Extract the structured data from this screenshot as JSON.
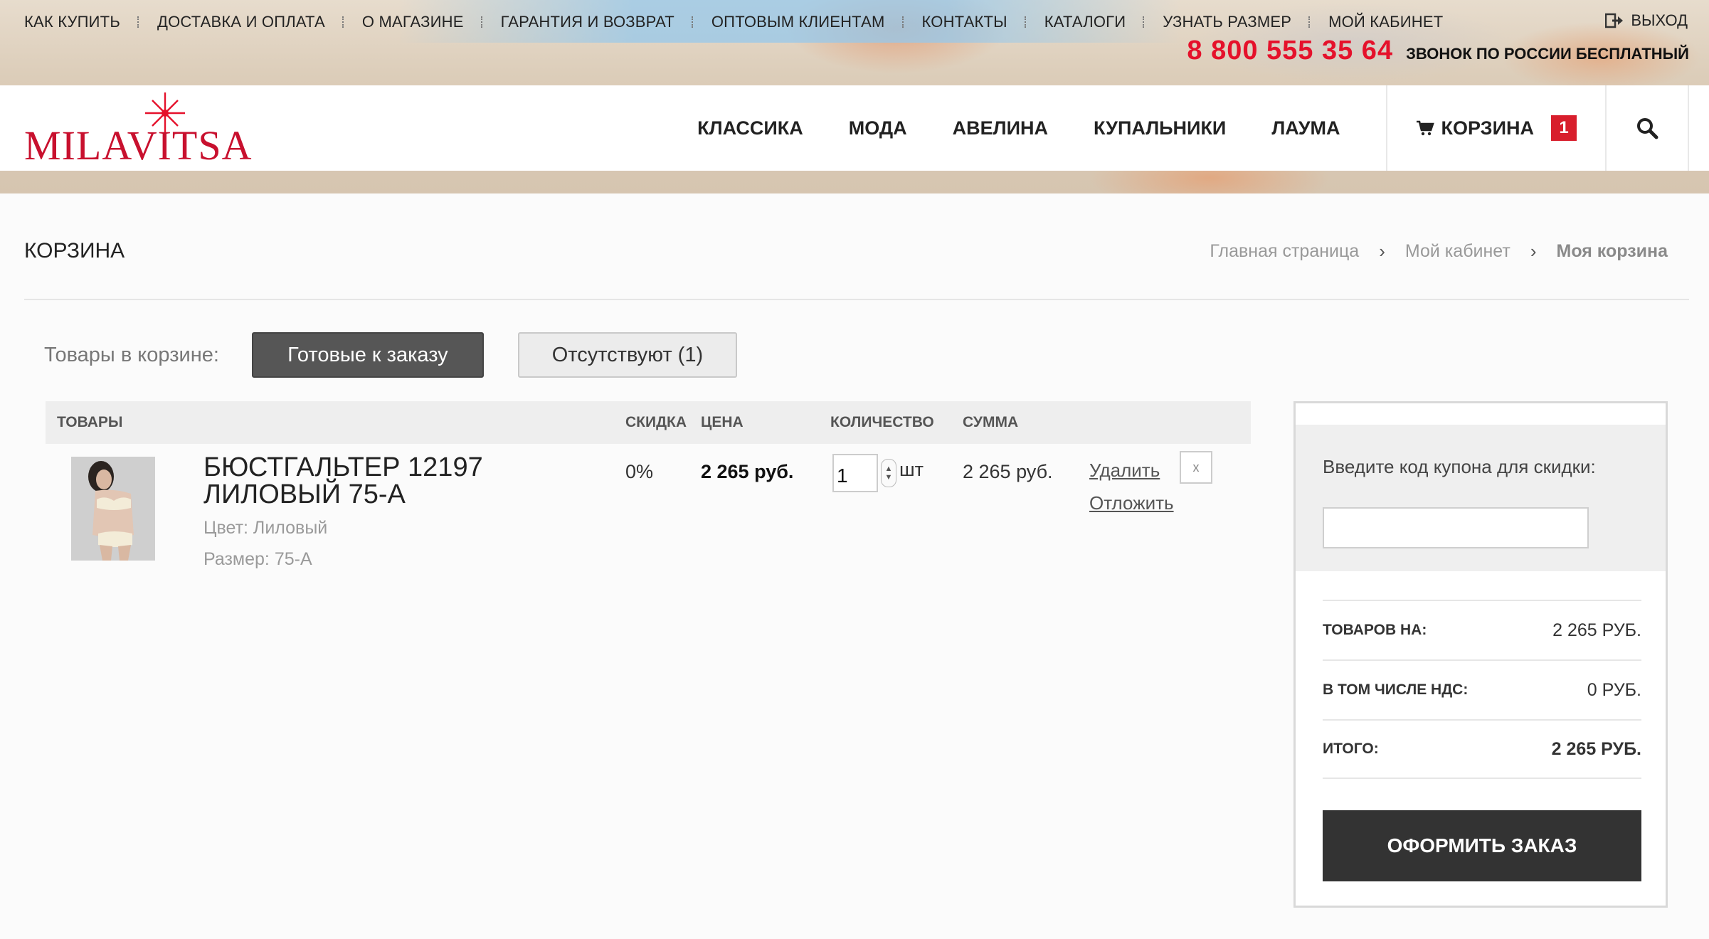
{
  "top_nav": {
    "items": [
      "Как купить",
      "Доставка и оплата",
      "О магазине",
      "Гарантия и возврат",
      "Оптовым клиентам",
      "Контакты",
      "Каталоги",
      "Узнать размер",
      "Мой кабинет"
    ],
    "logout_label": "Выход",
    "phone": "8 800 555 35 64",
    "phone_note": "Звонок по России бесплатный"
  },
  "brand": {
    "logo_text": "MILAVITSA",
    "accent_color": "#e5112b"
  },
  "main_nav": {
    "items": [
      "Классика",
      "Мода",
      "Авелина",
      "Купальники",
      "Лаума"
    ],
    "cart_label": "Корзина",
    "cart_count": "1"
  },
  "page": {
    "title": "Корзина",
    "breadcrumbs": [
      "Главная страница",
      "Мой кабинет",
      "Моя корзина"
    ]
  },
  "tabs": {
    "label": "Товары в корзине:",
    "ready": "Готовые к заказу",
    "missing": "Отсутствуют (1)"
  },
  "table": {
    "headers": {
      "product": "Товары",
      "discount": "Скидка",
      "price": "Цена",
      "quantity": "Количество",
      "sum": "Сумма"
    },
    "rows": [
      {
        "name": "Бюстгальтер 12197 лиловый 75-А",
        "color": "Цвет: Лиловый",
        "size": "Размер: 75-A",
        "discount": "0%",
        "price": "2 265 руб.",
        "quantity": "1",
        "unit": "шт",
        "sum": "2 265 руб.",
        "delete_label": "Удалить",
        "defer_label": "Отложить",
        "remove_label": "x"
      }
    ]
  },
  "summary": {
    "coupon_label": "Введите код купона для скидки:",
    "coupon_value": "",
    "rows": [
      {
        "label": "Товаров на:",
        "value": "2 265 руб."
      },
      {
        "label": "В том числе НДС:",
        "value": "0 руб."
      },
      {
        "label": "Итого:",
        "value": "2 265 руб."
      }
    ],
    "checkout_label": "Оформить заказ"
  }
}
